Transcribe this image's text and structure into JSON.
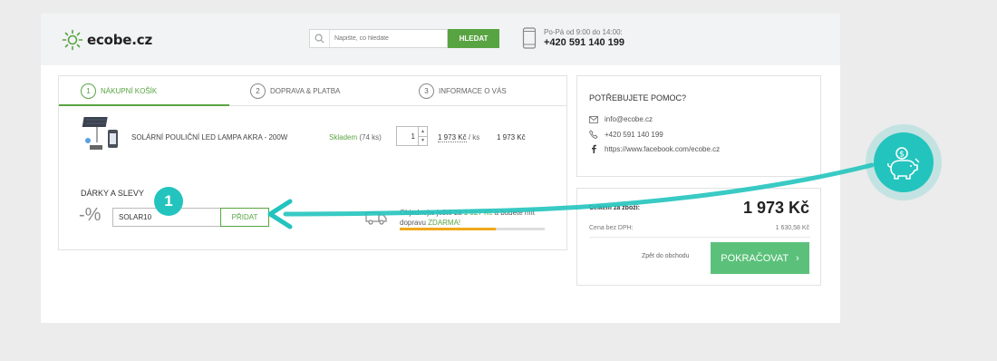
{
  "header": {
    "logo_text": "ecobe.cz",
    "search_placeholder": "Napište, co hledáte",
    "search_button": "HLEDAT",
    "hours": "Po-Pá od 9:00 do 14:00:",
    "phone": "+420 591 140 199"
  },
  "steps": [
    {
      "num": "1",
      "label": "NÁKUPNÍ KOŠÍK"
    },
    {
      "num": "2",
      "label": "DOPRAVA & PLATBA"
    },
    {
      "num": "3",
      "label": "INFORMACE O VÁS"
    }
  ],
  "item": {
    "name": "SOLÁRNÍ POULIČNÍ LED LAMPA AKRA - 200W",
    "stock": "Skladem",
    "stock_count": "(74 ks)",
    "qty": "1",
    "unit_price": "1 973 Kč",
    "unit_per": "/ ks",
    "total": "1 973 Kč"
  },
  "gifts": {
    "title": "DÁRKY A SLEVY",
    "percent": "-%",
    "coupon_value": "SOLAR10",
    "add_button": "PŘIDAT",
    "badge": "1"
  },
  "shipping": {
    "text_before": "Objednejte ještě za",
    "amount": "1 027 Kč",
    "text_after": "a budete mít",
    "text_line2": "dopravu",
    "free": "ZDARMA!",
    "progress": 0.66
  },
  "help": {
    "title": "POTŘEBUJETE POMOC?",
    "email": "info@ecobe.cz",
    "phone": "+420 591 140 199",
    "facebook": "https://www.facebook.com/ecobe.cz"
  },
  "summary": {
    "label": "Celkem za zboží:",
    "total": "1 973 Kč",
    "nodph_label": "Cena bez DPH:",
    "nodph_value": "1 630,58 Kč",
    "back_link": "Zpět do obchodu",
    "continue": "POKRAČOVAT"
  },
  "colors": {
    "green": "#58a442",
    "teal_annotation": "#23c4be",
    "continue": "#5bc17a",
    "progress": "#f0a81a"
  }
}
